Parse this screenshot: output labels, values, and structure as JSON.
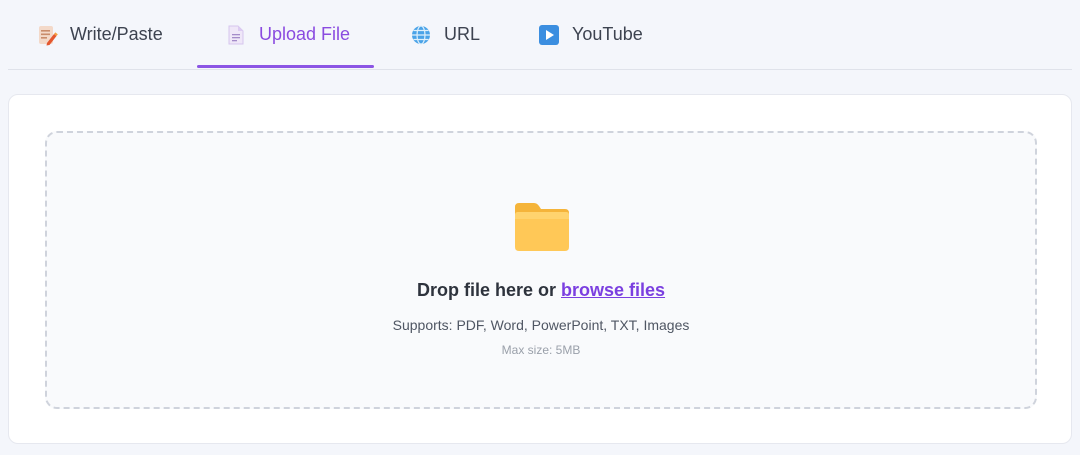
{
  "tabs": [
    {
      "label": "Write/Paste",
      "icon": "write-paste-icon"
    },
    {
      "label": "Upload File",
      "icon": "document-icon",
      "active": true
    },
    {
      "label": "URL",
      "icon": "globe-icon"
    },
    {
      "label": "YouTube",
      "icon": "play-icon"
    }
  ],
  "upload": {
    "prompt_prefix": "Drop file here or",
    "browse_label": "browse files",
    "supports": "Supports: PDF, Word, PowerPoint, TXT, Images",
    "max_size": "Max size: 5MB",
    "icon": "folder-icon"
  },
  "colors": {
    "accent": "#8b55e4",
    "link": "#7b3fe0",
    "folder": "#ffc857"
  }
}
